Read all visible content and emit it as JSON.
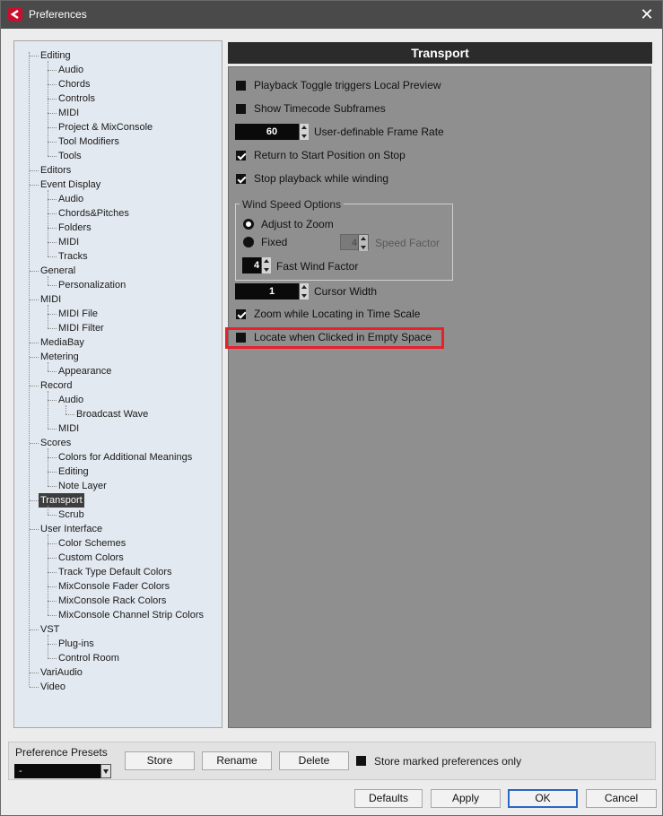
{
  "window": {
    "title": "Preferences",
    "close_glyph": "✕"
  },
  "tree": [
    {
      "label": "Editing",
      "level": 0
    },
    {
      "label": "Audio",
      "level": 1
    },
    {
      "label": "Chords",
      "level": 1
    },
    {
      "label": "Controls",
      "level": 1
    },
    {
      "label": "MIDI",
      "level": 1
    },
    {
      "label": "Project & MixConsole",
      "level": 1
    },
    {
      "label": "Tool Modifiers",
      "level": 1
    },
    {
      "label": "Tools",
      "level": 1
    },
    {
      "label": "Editors",
      "level": 0
    },
    {
      "label": "Event Display",
      "level": 0
    },
    {
      "label": "Audio",
      "level": 1
    },
    {
      "label": "Chords&Pitches",
      "level": 1
    },
    {
      "label": "Folders",
      "level": 1
    },
    {
      "label": "MIDI",
      "level": 1
    },
    {
      "label": "Tracks",
      "level": 1
    },
    {
      "label": "General",
      "level": 0
    },
    {
      "label": "Personalization",
      "level": 1
    },
    {
      "label": "MIDI",
      "level": 0
    },
    {
      "label": "MIDI File",
      "level": 1
    },
    {
      "label": "MIDI Filter",
      "level": 1
    },
    {
      "label": "MediaBay",
      "level": 0
    },
    {
      "label": "Metering",
      "level": 0
    },
    {
      "label": "Appearance",
      "level": 1
    },
    {
      "label": "Record",
      "level": 0
    },
    {
      "label": "Audio",
      "level": 1
    },
    {
      "label": "Broadcast Wave",
      "level": 2
    },
    {
      "label": "MIDI",
      "level": 1
    },
    {
      "label": "Scores",
      "level": 0
    },
    {
      "label": "Colors for Additional Meanings",
      "level": 1
    },
    {
      "label": "Editing",
      "level": 1
    },
    {
      "label": "Note Layer",
      "level": 1
    },
    {
      "label": "Transport",
      "level": 0,
      "selected": true
    },
    {
      "label": "Scrub",
      "level": 1
    },
    {
      "label": "User Interface",
      "level": 0
    },
    {
      "label": "Color Schemes",
      "level": 1
    },
    {
      "label": "Custom Colors",
      "level": 1
    },
    {
      "label": "Track Type Default Colors",
      "level": 1
    },
    {
      "label": "MixConsole Fader Colors",
      "level": 1
    },
    {
      "label": "MixConsole Rack Colors",
      "level": 1
    },
    {
      "label": "MixConsole Channel Strip Colors",
      "level": 1
    },
    {
      "label": "VST",
      "level": 0
    },
    {
      "label": "Plug-ins",
      "level": 1
    },
    {
      "label": "Control Room",
      "level": 1
    },
    {
      "label": "VariAudio",
      "level": 0
    },
    {
      "label": "Video",
      "level": 0
    }
  ],
  "transport": {
    "header": "Transport",
    "playback_toggle": {
      "label": "Playback Toggle triggers Local Preview",
      "checked": false
    },
    "timecode_subframes": {
      "label": "Show Timecode Subframes",
      "checked": false
    },
    "frame_rate": {
      "value": "60",
      "label": "User-definable Frame Rate"
    },
    "return_to_start": {
      "label": "Return to Start Position on Stop",
      "checked": true
    },
    "stop_winding": {
      "label": "Stop playback while winding",
      "checked": true
    },
    "wind_speed": {
      "title": "Wind Speed Options",
      "adjust_to_zoom": {
        "label": "Adjust to Zoom",
        "selected": true
      },
      "fixed": {
        "label": "Fixed",
        "selected": false
      },
      "speed_factor": {
        "value": "4",
        "label": "Speed Factor"
      },
      "fast_wind": {
        "value": "4",
        "label": "Fast Wind Factor"
      }
    },
    "cursor_width": {
      "value": "1",
      "label": "Cursor Width"
    },
    "zoom_locating": {
      "label": "Zoom while Locating in Time Scale",
      "checked": true
    },
    "locate_empty": {
      "label": "Locate when Clicked in Empty Space",
      "checked": false
    }
  },
  "presets": {
    "label": "Preference Presets",
    "selected": "-",
    "store": "Store",
    "rename": "Rename",
    "delete": "Delete",
    "store_marked": {
      "label": "Store marked preferences only",
      "checked": false
    }
  },
  "footer": {
    "defaults": "Defaults",
    "apply": "Apply",
    "ok": "OK",
    "cancel": "Cancel"
  },
  "colors": {
    "highlight": "#e8202a",
    "title_bar": "#4a4a4a",
    "tree_bg": "#e3e9f0",
    "content_bg": "#8f8f8f"
  }
}
